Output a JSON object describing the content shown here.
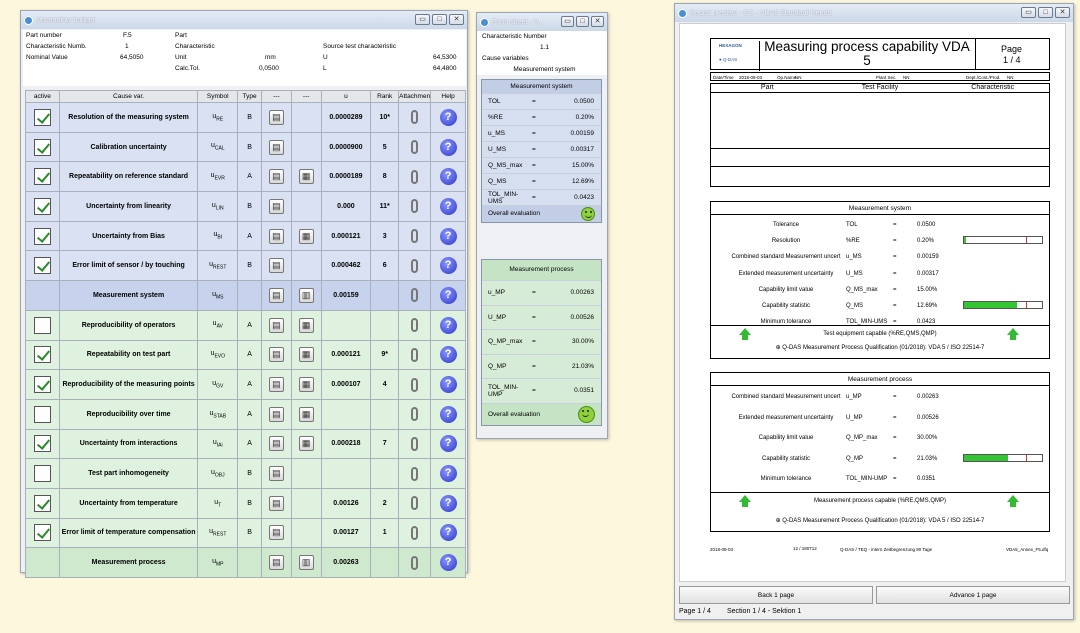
{
  "ub": {
    "title": "Uncertainty budget",
    "h": {
      "l1": "Part number",
      "v1": "F.5",
      "l1b": "Part",
      "l2": "Characteristic Numb.",
      "v2": "1",
      "l2b": "Characteristic",
      "l3": "Nominal Value",
      "v3": "64,5050",
      "l3b": "Unit",
      "u3": "mm",
      "l4b": "Calc.Tol.",
      "v4b": "0,0500",
      "src": "Source test characteristic",
      "U": "U",
      "Uv": "64,5300",
      "L": "L",
      "Lv": "64,4800"
    },
    "cols": [
      "active",
      "Cause var.",
      "Symbol",
      "Type",
      "---",
      "---",
      "u",
      "Rank",
      "Attachmen",
      "Help"
    ],
    "rows": [
      {
        "on": true,
        "c": "Resolution of the measuring system",
        "s": "u",
        "sub": "RE",
        "t": "B",
        "g1": true,
        "g2": false,
        "u": "0.0000289",
        "r": "10*",
        "k": "b"
      },
      {
        "on": true,
        "c": "Calibration uncertainty",
        "s": "u",
        "sub": "CAL",
        "t": "B",
        "g1": true,
        "g2": false,
        "u": "0.0000900",
        "r": "5",
        "k": "b"
      },
      {
        "on": true,
        "c": "Repeatability on reference standard",
        "s": "u",
        "sub": "EVR",
        "t": "A",
        "g1": true,
        "g2": true,
        "u": "0.0000189",
        "r": "8",
        "k": "b"
      },
      {
        "on": true,
        "c": "Uncertainty from linearity",
        "s": "u",
        "sub": "LIN",
        "t": "B",
        "g1": true,
        "g2": false,
        "u": "0.000",
        "r": "11*",
        "k": "b"
      },
      {
        "on": true,
        "c": "Uncertainty from Bias",
        "s": "u",
        "sub": "BI",
        "t": "A",
        "g1": true,
        "g2": true,
        "u": "0.000121",
        "r": "3",
        "k": "b"
      },
      {
        "on": true,
        "c": "Error limit of sensor / by touching",
        "s": "u",
        "sub": "REST",
        "t": "B",
        "g1": true,
        "g2": false,
        "u": "0.000462",
        "r": "6",
        "k": "b"
      },
      {
        "on": null,
        "c": "Measurement system",
        "s": "u",
        "sub": "MS",
        "t": "",
        "g1": true,
        "g2": "grid",
        "u": "0.00159",
        "r": "",
        "k": "s"
      },
      {
        "on": false,
        "c": "Reproducibility of operators",
        "s": "u",
        "sub": "AV",
        "t": "A",
        "g1": true,
        "g2": true,
        "u": "",
        "r": "",
        "k": "g"
      },
      {
        "on": true,
        "c": "Repeatability on test part",
        "s": "u",
        "sub": "EVO",
        "t": "A",
        "g1": true,
        "g2": true,
        "u": "0.000121",
        "r": "9*",
        "k": "g"
      },
      {
        "on": true,
        "c": "Reproducibility of the measuring points",
        "s": "u",
        "sub": "GV",
        "t": "A",
        "g1": true,
        "g2": true,
        "u": "0.000107",
        "r": "4",
        "k": "g"
      },
      {
        "on": false,
        "c": "Reproducibility over time",
        "s": "u",
        "sub": "STAB",
        "t": "A",
        "g1": true,
        "g2": true,
        "u": "",
        "r": "",
        "k": "g"
      },
      {
        "on": true,
        "c": "Uncertainty from interactions",
        "s": "u",
        "sub": "IAi",
        "t": "A",
        "g1": true,
        "g2": true,
        "u": "0.000218",
        "r": "7",
        "k": "g"
      },
      {
        "on": false,
        "c": "Test part inhomogeneity",
        "s": "u",
        "sub": "OBJ",
        "t": "B",
        "g1": true,
        "g2": false,
        "u": "",
        "r": "",
        "k": "g"
      },
      {
        "on": true,
        "c": "Uncertainty from temperature",
        "s": "u",
        "sub": "T",
        "t": "B",
        "g1": true,
        "g2": false,
        "u": "0.00126",
        "r": "2",
        "k": "g"
      },
      {
        "on": true,
        "c": "Error limit of temperature compensation",
        "s": "u",
        "sub": "REST",
        "t": "B",
        "g1": true,
        "g2": false,
        "u": "0.00127",
        "r": "1",
        "k": "g"
      },
      {
        "on": null,
        "c": "Measurement process",
        "s": "u",
        "sub": "MP",
        "t": "",
        "g1": true,
        "g2": "grid",
        "u": "0.00263",
        "r": "",
        "k": "p"
      }
    ]
  },
  "fs": {
    "title": "Form sheet - V...",
    "cn": "Characteristic Number",
    "cnv": "1.1",
    "cv": "Cause variables",
    "ms": "Measurement system",
    "msr": [
      [
        "TOL",
        "=",
        "0.0500"
      ],
      [
        "%RE",
        "=",
        "0.20%"
      ],
      [
        "u_MS",
        "=",
        "0.00159"
      ],
      [
        "U_MS",
        "=",
        "0.00317"
      ],
      [
        "Q_MS_max",
        "=",
        "15.00%"
      ],
      [
        "Q_MS",
        "=",
        "12.69%"
      ],
      [
        "TOL_MIN-UMS",
        "=",
        "0.0423"
      ]
    ],
    "ov": "Overall evaluation",
    "mp": "Measurement process",
    "mpr": [
      [
        "u_MP",
        "=",
        "0.00263"
      ],
      [
        "U_MP",
        "=",
        "0.00526"
      ],
      [
        "Q_MP_max",
        "=",
        "30.00%"
      ],
      [
        "Q_MP",
        "=",
        "21.03%"
      ],
      [
        "TOL_MIN-UMP",
        "=",
        "0.0351"
      ]
    ]
  },
  "rp": {
    "title": "Report preview - GC - VDA5 Standard Report",
    "head": "Measuring process capability VDA 5",
    "page": "Page",
    "pagev": "1 / 4",
    "logo": "HEXAGON",
    "qdas": "Q-DAS",
    "info": [
      "Date/Time",
      "2018-08-03",
      "Op.Name.",
      "NN",
      "Plant Sec.",
      "NN",
      "Dept./Cost./Prod.",
      "NN"
    ],
    "sec": [
      "Part",
      "Test Facility",
      "Characteristic"
    ],
    "ms_title": "Measurement system",
    "ms": [
      [
        "Tolerance",
        "TOL",
        "=",
        "0.0500"
      ],
      [
        "Resolution",
        "%RE",
        "=",
        "0.20%"
      ],
      [
        "Combined standard Measurement uncert",
        "u_MS",
        "=",
        "0.00159"
      ],
      [
        "Extended measurement uncertainty",
        "U_MS",
        "=",
        "0.00317"
      ],
      [
        "Capability limit value",
        "Q_MS_max",
        "=",
        "15.00%"
      ],
      [
        "Capability statistic",
        "Q_MS",
        "=",
        "12.69%"
      ],
      [
        "Minimum tolerance",
        "TOL_MIN-UMS",
        "=",
        "0.0423"
      ]
    ],
    "ms_ok": "Test equipment capable (%RE,QMS,QMP)",
    "std": "Q-DAS Measurement Process Qualification (01/2018): VDA 5 / ISO 22514-7",
    "mp_title": "Measurement process",
    "mp": [
      [
        "Combined standard Measurement uncert",
        "u_MP",
        "=",
        "0.00263"
      ],
      [
        "Extended measurement uncertainty",
        "U_MP",
        "=",
        "0.00526"
      ],
      [
        "Capability limit value",
        "Q_MP_max",
        "=",
        "30.00%"
      ],
      [
        "Capability statistic",
        "Q_MP",
        "=",
        "21.03%"
      ],
      [
        "Minimum tolerance",
        "TOL_MIN-UMP",
        "=",
        "0.0351"
      ]
    ],
    "mp_ok": "Measurement process capable (%RE,QMS,QMP)",
    "foot": [
      "2018-08-03",
      "12 / 180712",
      "Q-DAS / TEQ - intern Zeitbegrenzung 90 Tage",
      "VDA5_Annex_F5.dfq"
    ],
    "b1": "Back 1 page",
    "b2": "Advance 1 page",
    "st1": "Page 1 / 4",
    "st2": "Section 1 / 4 - Sektion 1",
    "bars": {
      "re": 0.2,
      "re_max": 5,
      "qms": 12.69,
      "qms_max": 15,
      "qmp": 21.03,
      "qmp_max": 30
    }
  },
  "colors": {
    "blue_row": "#d9e1f2",
    "green_row": "#dff2df",
    "check": "#2a8a2a"
  }
}
